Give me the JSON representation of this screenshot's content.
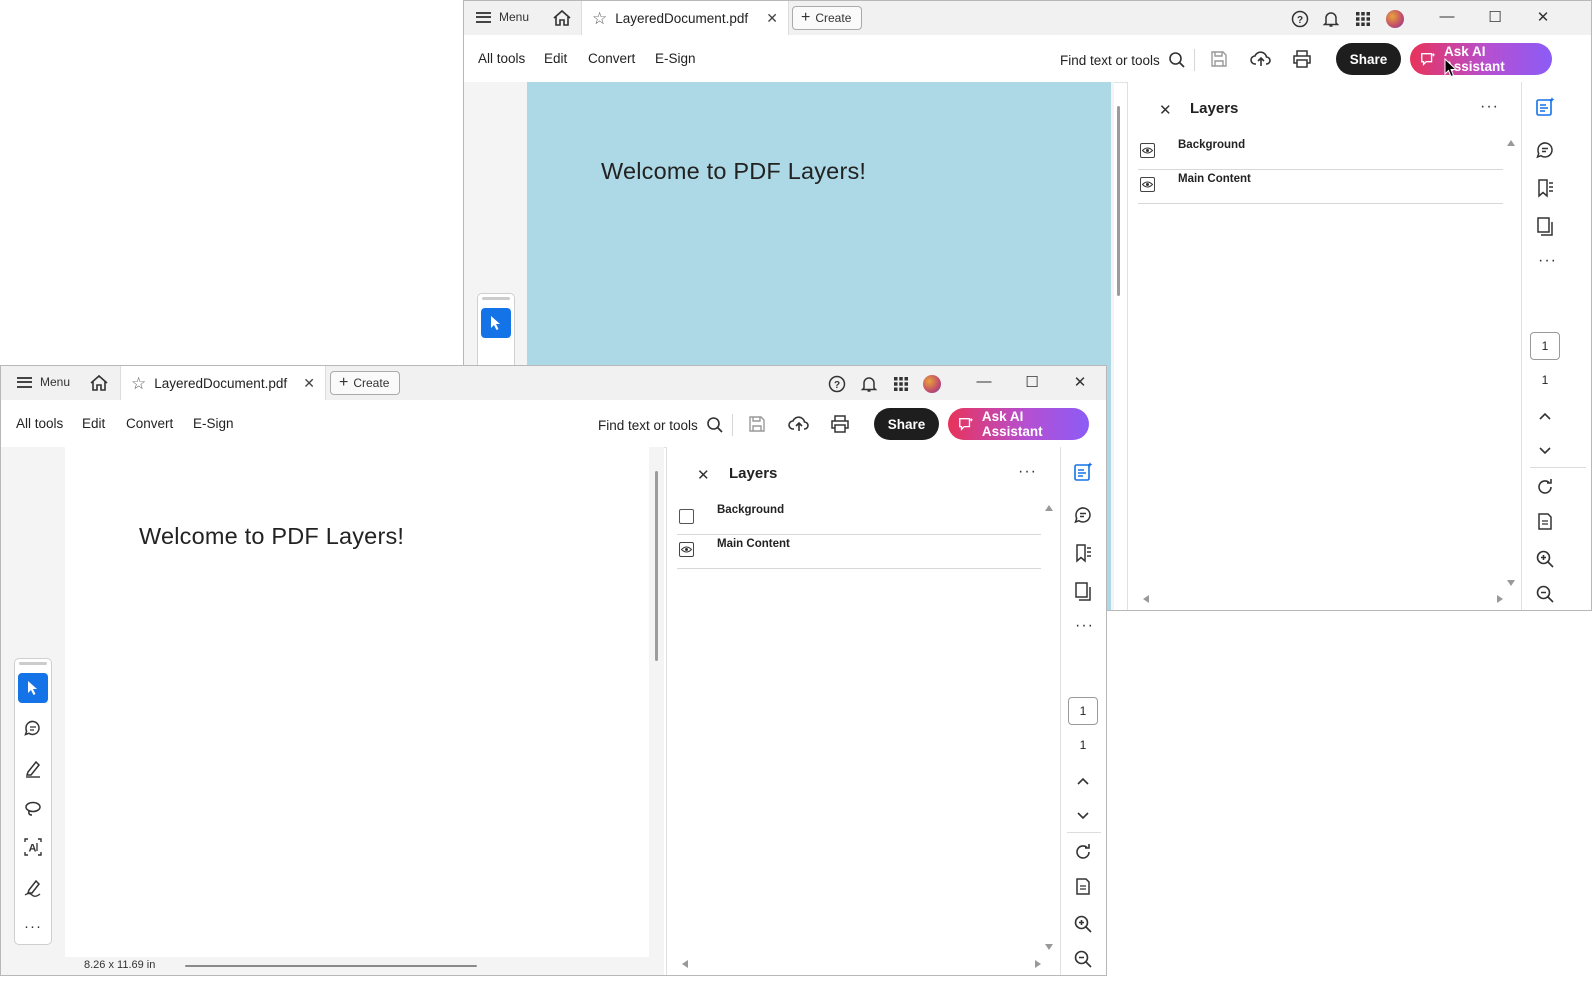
{
  "app": {
    "menu_label": "Menu",
    "tab_title": "LayeredDocument.pdf",
    "create_label": "Create"
  },
  "toolbar": {
    "all_tools": "All tools",
    "edit": "Edit",
    "convert": "Convert",
    "e_sign": "E-Sign",
    "find_placeholder": "Find text or tools",
    "share_label": "Share",
    "ai_label": "Ask AI Assistant"
  },
  "document": {
    "heading": "Welcome to PDF Layers!",
    "page_size": "8.26 x 11.69 in",
    "background_color_back": "#add8e6",
    "background_color_front": "#ffffff"
  },
  "layers_panel": {
    "title": "Layers",
    "back_window_layers": [
      {
        "name": "Background",
        "visible": true
      },
      {
        "name": "Main Content",
        "visible": true
      }
    ],
    "front_window_layers": [
      {
        "name": "Background",
        "visible": false
      },
      {
        "name": "Main Content",
        "visible": true
      }
    ]
  },
  "page_nav": {
    "current_page": "1",
    "total_pages": "1"
  },
  "colors": {
    "accent_blue": "#1473e6",
    "share_bg": "#1e1e1e",
    "ai_gradient_start": "#e8335a",
    "ai_gradient_end": "#8b5cf6"
  }
}
